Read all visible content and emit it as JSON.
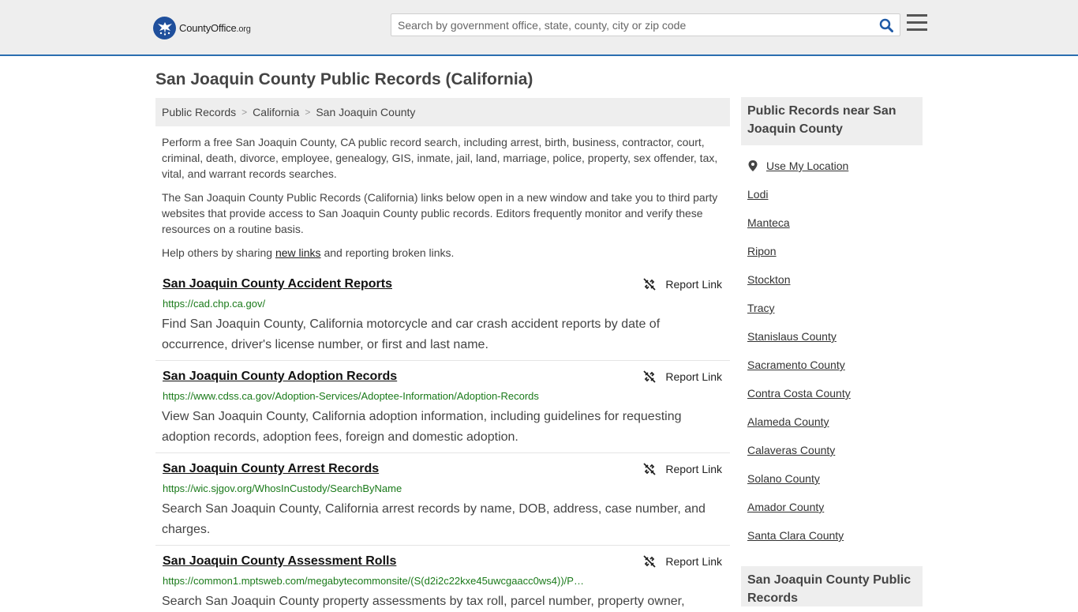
{
  "header": {
    "logo_text": "CountyOffice",
    "logo_tld": ".org",
    "search_placeholder": "Search by government office, state, county, city or zip code"
  },
  "page_title": "San Joaquin County Public Records (California)",
  "breadcrumb": [
    "Public Records",
    "California",
    "San Joaquin County"
  ],
  "intro": {
    "para1": "Perform a free San Joaquin County, CA public record search, including arrest, birth, business, contractor, court, criminal, death, divorce, employee, genealogy, GIS, inmate, jail, land, marriage, police, property, sex offender, tax, vital, and warrant records searches.",
    "para2": "The San Joaquin County Public Records (California) links below open in a new window and take you to third party websites that provide access to San Joaquin County public records. Editors frequently monitor and verify these resources on a routine basis.",
    "para3_before": "Help others by sharing ",
    "para3_link": "new links",
    "para3_after": " and reporting broken links."
  },
  "report_label": "Report Link",
  "records": [
    {
      "title": "San Joaquin County Accident Reports",
      "url": "https://cad.chp.ca.gov/",
      "desc": "Find San Joaquin County, California motorcycle and car crash accident reports by date of occurrence, driver's license number, or first and last name."
    },
    {
      "title": "San Joaquin County Adoption Records",
      "url": "https://www.cdss.ca.gov/Adoption-Services/Adoptee-Information/Adoption-Records",
      "desc": "View San Joaquin County, California adoption information, including guidelines for requesting adoption records, adoption fees, foreign and domestic adoption."
    },
    {
      "title": "San Joaquin County Arrest Records",
      "url": "https://wic.sjgov.org/WhosInCustody/SearchByName",
      "desc": "Search San Joaquin County, California arrest records by name, DOB, address, case number, and charges."
    },
    {
      "title": "San Joaquin County Assessment Rolls",
      "url": "https://common1.mptsweb.com/megabytecommonsite/(S(d2i2c22kxe45uwcgaacc0ws4))/P…",
      "desc": "Search San Joaquin County property assessments by tax roll, parcel number, property owner,"
    }
  ],
  "sidebar": {
    "heading": "Public Records near San Joaquin County",
    "use_location": "Use My Location",
    "links": [
      "Lodi",
      "Manteca",
      "Ripon",
      "Stockton",
      "Tracy",
      "Stanislaus County",
      "Sacramento County",
      "Contra Costa County",
      "Alameda County",
      "Calaveras County",
      "Solano County",
      "Amador County",
      "Santa Clara County"
    ],
    "heading2": "San Joaquin County Public Records"
  }
}
